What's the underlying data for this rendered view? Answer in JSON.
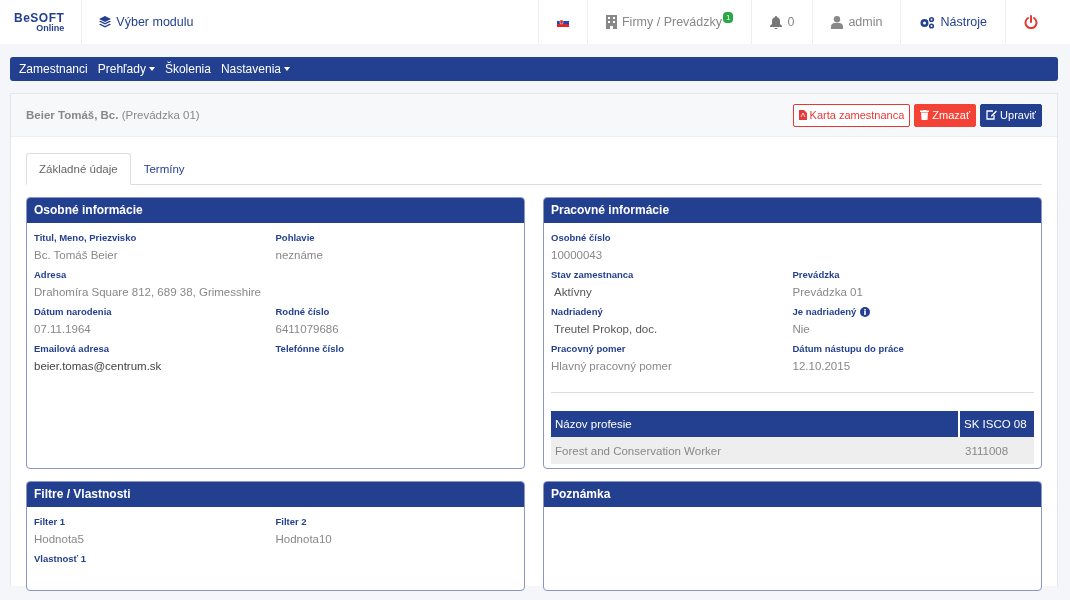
{
  "header": {
    "logo": {
      "main": "BeSOFT",
      "sub": "Online"
    },
    "module_link": "Výber modulu",
    "items": [
      {
        "kind": "flag"
      },
      {
        "kind": "company",
        "label": "Firmy / Prevádzky",
        "badge": "1"
      },
      {
        "kind": "bell",
        "label": "0"
      },
      {
        "kind": "user",
        "label": "admin"
      },
      {
        "kind": "tools",
        "label": "Nástroje"
      },
      {
        "kind": "power"
      }
    ]
  },
  "nav": [
    {
      "label": "Zamestnanci",
      "dropdown": false
    },
    {
      "label": "Prehľady",
      "dropdown": true
    },
    {
      "label": "Školenia",
      "dropdown": false
    },
    {
      "label": "Nastavenia",
      "dropdown": true
    }
  ],
  "employee": {
    "name": "Beier Tomáš, Bc.",
    "branch": "(Prevádzka 01)"
  },
  "actions": [
    {
      "kind": "outline",
      "label": "Karta zamestnanca"
    },
    {
      "kind": "danger",
      "label": "Zmazať"
    },
    {
      "kind": "primary",
      "label": "Upraviť"
    }
  ],
  "tabs": [
    {
      "label": "Základné údaje",
      "selected": true
    },
    {
      "label": "Termíny",
      "selected": false
    }
  ],
  "panels": [
    {
      "title": "Osobné informácie",
      "rows": [
        [
          {
            "label": "Titul, Meno, Priezvisko",
            "value": "Bc. Tomáš Beier",
            "kind": "muted"
          },
          {
            "label": "Pohlavie",
            "value": "neznáme",
            "kind": "muted"
          }
        ],
        [
          {
            "label": "Adresa",
            "value": "Drahomíra Square 812, 689 38, Grimesshire",
            "kind": "muted"
          }
        ],
        [
          {
            "label": "Dátum narodenia",
            "value": "07.11.1964",
            "kind": "muted"
          },
          {
            "label": "Rodné číslo",
            "value": "6411079686",
            "kind": "muted"
          }
        ],
        [
          {
            "label": "Emailová adresa",
            "value": "beier.tomas@centrum.sk",
            "kind": "dark"
          },
          {
            "label": "Telefónne číslo"
          }
        ]
      ]
    },
    {
      "title": "Pracovné informácie",
      "rows": [
        [
          {
            "label": "Osobné číslo",
            "value": "10000043",
            "kind": "muted"
          }
        ],
        [
          {
            "label": "Stav zamestnanca",
            "value": "Aktívny",
            "kind": "select"
          },
          {
            "label": "Prevádzka",
            "value": "Prevádzka 01",
            "kind": "muted"
          }
        ],
        [
          {
            "label": "Nadriadený",
            "value": "Treutel Prokop, doc.",
            "kind": "select"
          },
          {
            "label": "Je nadriadený",
            "value": "Nie",
            "kind": "muted",
            "info": true
          }
        ],
        [
          {
            "label": "Pracovný pomer",
            "value": "Hlavný pracovný pomer",
            "kind": "muted"
          },
          {
            "label": "Dátum nástupu do práce",
            "value": "12.10.2015",
            "kind": "muted"
          }
        ]
      ],
      "table": {
        "columns": [
          "Názov profesie",
          "SK ISCO 08"
        ],
        "rows": [
          [
            "Forest and Conservation Worker",
            "3111008"
          ]
        ]
      }
    },
    {
      "title": "Filtre / Vlastnosti",
      "rows": [
        [
          {
            "label": "Filter 1",
            "value": "Hodnota5",
            "kind": "muted"
          },
          {
            "label": "Filter 2",
            "value": "Hodnota10",
            "kind": "muted"
          }
        ],
        [
          {
            "label": "Vlastnosť 1"
          }
        ]
      ]
    },
    {
      "title": "Poznámka"
    }
  ]
}
